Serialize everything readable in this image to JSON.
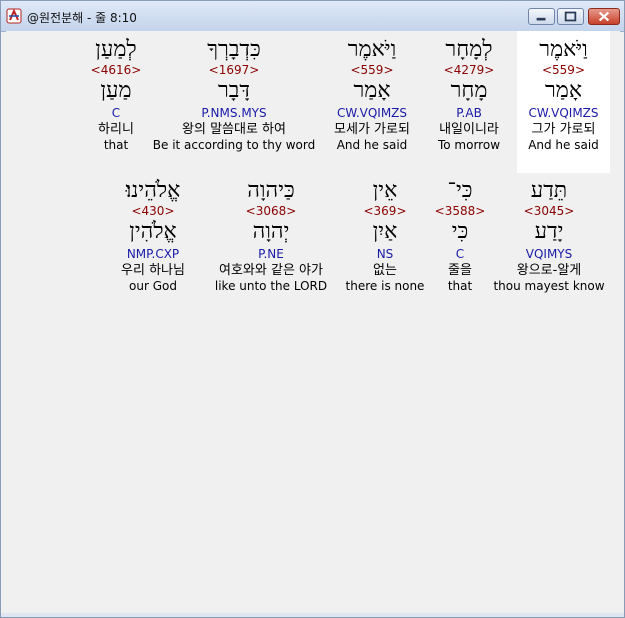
{
  "window": {
    "title": "@원전분해 - 줄 8:10"
  },
  "rows": [
    {
      "words": [
        {
          "hebrew": "וַיֹּאמֶר",
          "strong": "<559>",
          "lemma": "אָמַר",
          "morph": "CW.VQIMZS",
          "korean": "그가 가로되",
          "english": "And he said",
          "selected": true
        },
        {
          "hebrew": "לְמָחָר",
          "strong": "<4279>",
          "lemma": "מָחָר",
          "morph": "P.AB",
          "korean": "내일이니라",
          "english": "To morrow",
          "selected": false
        },
        {
          "hebrew": "וַיֹּאמֶר",
          "strong": "<559>",
          "lemma": "אָמַר",
          "morph": "CW.VQIMZS",
          "korean": "모세가 가로되",
          "english": "And he said",
          "selected": false
        },
        {
          "hebrew": "כִּדְבָרְךָ",
          "strong": "<1697>",
          "lemma": "דָּבָר",
          "morph": "P.NMS.MYS",
          "korean": "왕의 말씀대로 하여",
          "english": "Be it according to thy word",
          "selected": false
        },
        {
          "hebrew": "לְמַעַן",
          "strong": "<4616>",
          "lemma": "מַעַן",
          "morph": "C",
          "korean": "하리니",
          "english": "that",
          "selected": false
        }
      ]
    },
    {
      "words": [
        {
          "hebrew": "תֵּדַע",
          "strong": "<3045>",
          "lemma": "יָדַע",
          "morph": "VQIMYS",
          "korean": "왕으로-알게",
          "english": "thou mayest know",
          "selected": false
        },
        {
          "hebrew": "כִּי־",
          "strong": "<3588>",
          "lemma": "כִּי",
          "morph": "C",
          "korean": "줄을",
          "english": "that",
          "selected": false
        },
        {
          "hebrew": "אֵין",
          "strong": "<369>",
          "lemma": "אַיִן",
          "morph": "NS",
          "korean": "없는",
          "english": "there is none",
          "selected": false
        },
        {
          "hebrew": "כַּיהוָה",
          "strong": "<3068>",
          "lemma": "יְהוָה",
          "morph": "P.NE",
          "korean": "여호와와 같은 야가",
          "english": "like unto the LORD",
          "selected": false
        },
        {
          "hebrew": "אֱלֹהֵינוּ׃",
          "strong": "<430>",
          "lemma": "אֱלֹהִין",
          "morph": "NMP.CXP",
          "korean": "우리 하나님",
          "english": "our God",
          "selected": false
        }
      ]
    }
  ]
}
